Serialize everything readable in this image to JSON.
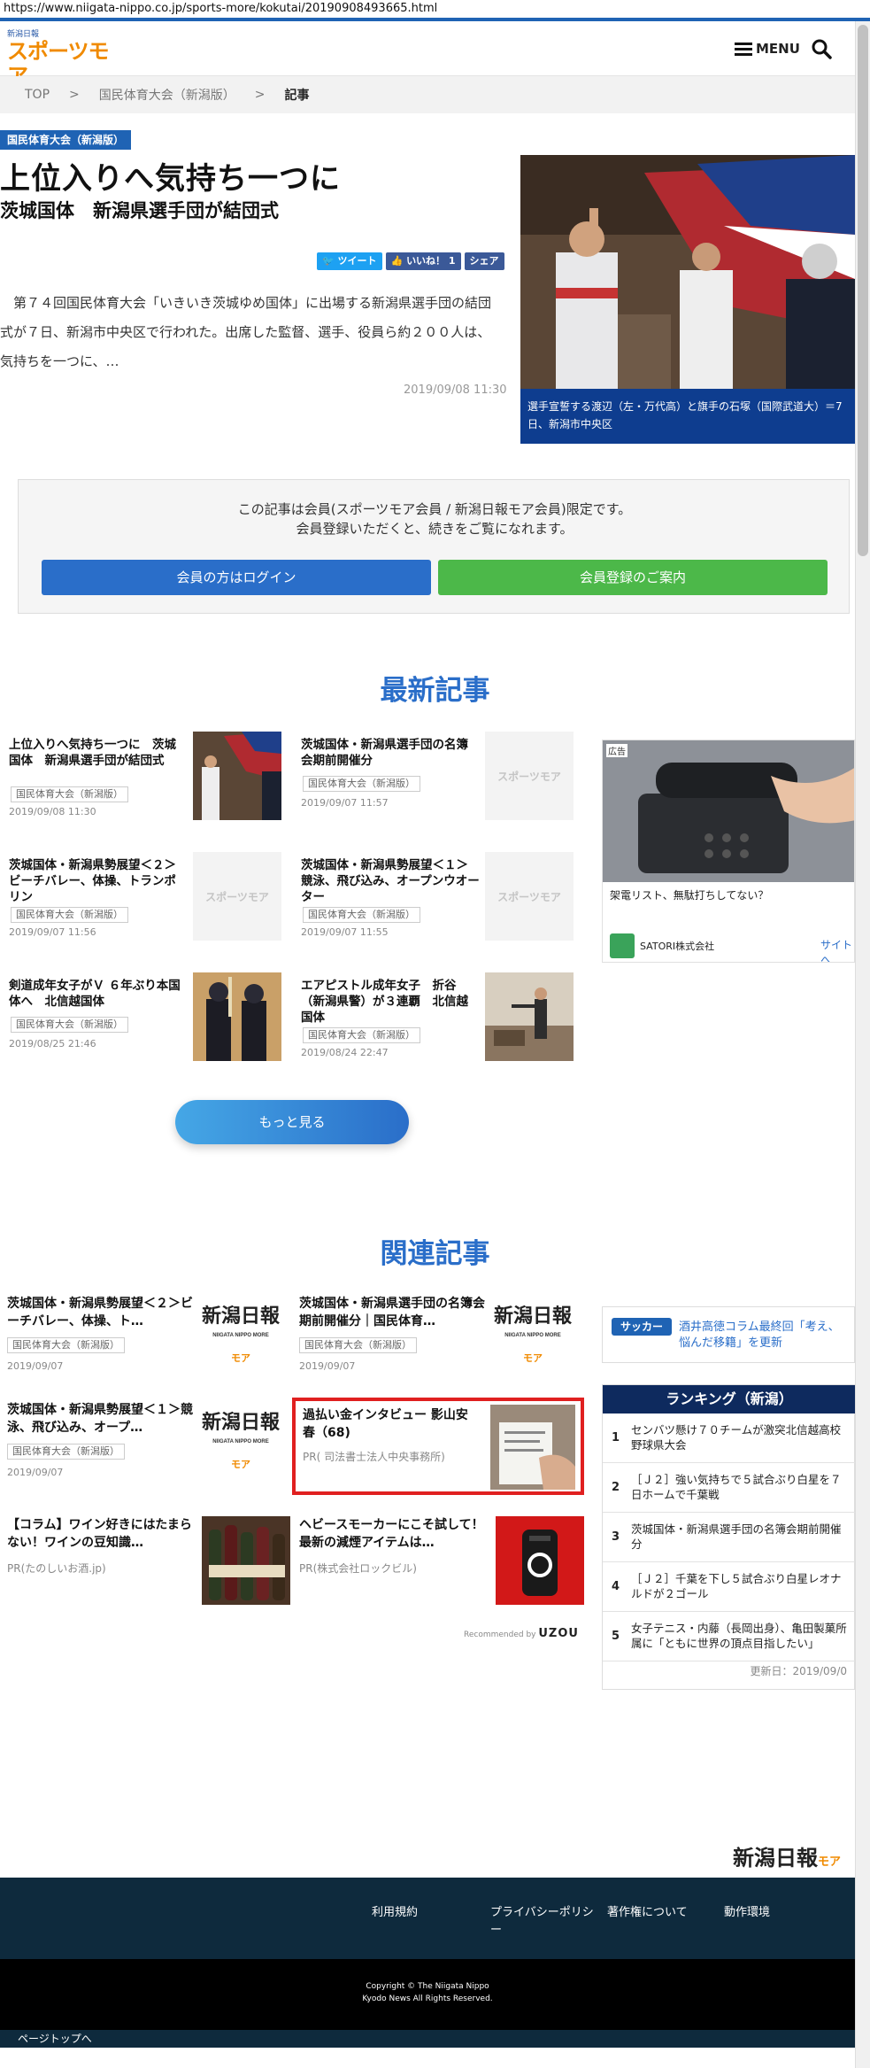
{
  "browser": {
    "url": "https://www.niigata-nippo.co.jp/sports-more/kokutai/20190908493665.html"
  },
  "header": {
    "logo_small": "新潟日報",
    "logo_main": "スポーツモア",
    "menu_label": "MENU"
  },
  "breadcrumb": [
    "TOP",
    ">",
    "国民体育大会（新潟版）",
    ">",
    "記事"
  ],
  "article": {
    "category": "国民体育大会（新潟版）",
    "title": "上位入りへ気持ち一つに",
    "subtitle": "茨城国体　新潟県選手団が結団式",
    "share": {
      "tweet": "ツイート",
      "like": "いいね！ 1",
      "share": "シェア"
    },
    "lead": "第７４回国民体育大会「いきいき茨城ゆめ国体」に出場する新潟県選手団の結団式が７日、新潟市中央区で行われた。出席した監督、選手、役員ら約２００人は、気持ちを一つに、…",
    "date": "2019/09/08 11:30",
    "photo_caption": "選手宣誓する渡辺（左・万代高）と旗手の石塚（国際武道大）＝7日、新潟市中央区"
  },
  "paywall": {
    "line1": "この記事は会員(スポーツモア会員 / 新潟日報モア会員)限定です。",
    "line2": "会員登録いただくと、続きをご覧になれます。",
    "login": "会員の方はログイン",
    "register": "会員登録のご案内"
  },
  "latest": {
    "heading": "最新記事",
    "items": [
      {
        "title": "上位入りへ気持ち一つに　茨城国体　新潟県選手団が結団式",
        "tag": "国民体育大会（新潟版）",
        "date": "2019/09/08 11:30"
      },
      {
        "title": "茨城国体・新潟県選手団の名簿　会期前開催分",
        "tag": "国民体育大会（新潟版）",
        "date": "2019/09/07 11:57"
      },
      {
        "title": "茨城国体・新潟県勢展望＜２＞　ビーチバレー、体操、トランポリン",
        "tag": "国民体育大会（新潟版）",
        "date": "2019/09/07 11:56"
      },
      {
        "title": "茨城国体・新潟県勢展望＜１＞　競泳、飛び込み、オープンウオーター",
        "tag": "国民体育大会（新潟版）",
        "date": "2019/09/07 11:55"
      },
      {
        "title": "剣道成年女子がＶ ６年ぶり本国体へ　北信越国体",
        "tag": "国民体育大会（新潟版）",
        "date": "2019/08/25 21:46"
      },
      {
        "title": "エアピストル成年女子　折谷（新潟県警）が３連覇　北信越国体",
        "tag": "国民体育大会（新潟版）",
        "date": "2019/08/24 22:47"
      }
    ],
    "placeholder_logo": "スポーツモア",
    "more": "もっと見る"
  },
  "ad": {
    "label": "広告",
    "text": "架電リスト、無駄打ちしてない？",
    "sponsor": "SATORI株式会社",
    "link": "サイトへ"
  },
  "related": {
    "heading": "関連記事",
    "items": [
      {
        "title": "茨城国体・新潟県勢展望＜２＞ビーチバレー、体操、ト…",
        "tag": "国民体育大会（新潟版）",
        "date": "2019/09/07"
      },
      {
        "title": "茨城国体・新潟県選手団の名簿会期前開催分｜国民体育…",
        "tag": "国民体育大会（新潟版）",
        "date": "2019/09/07"
      },
      {
        "title": "茨城国体・新潟県勢展望＜１＞競泳、飛び込み、オープ…",
        "tag": "国民体育大会（新潟版）",
        "date": "2019/09/07"
      },
      {
        "title": "過払い金インタビュー 影山安春（68)",
        "pr": "PR( 司法書士法人中央事務所)"
      },
      {
        "title": "【コラム】ワイン好きにはたまらない！ワインの豆知識…",
        "pr": "PR(たのしいお酒.jp)"
      },
      {
        "title": "ヘビースモーカーにこそ試して！最新の減煙アイテムは…",
        "pr": "PR(株式会社ロックビル)"
      }
    ],
    "logo_text": "新潟日報",
    "logo_sub": "NIIGATA NIPPO MORE",
    "logo_more": "モア",
    "recommended_by": "Recommended by",
    "uzou": "UZOU"
  },
  "sidebar": {
    "soccer_tag": "サッカー",
    "soccer_text": "酒井高徳コラム最終回「考え、悩んだ移籍」を更新",
    "ranking_title": "ランキング（新潟）",
    "ranking": [
      {
        "n": "1",
        "text": "センバツ懸け７０チームが激突北信越高校野球県大会"
      },
      {
        "n": "2",
        "text": "［Ｊ２］強い気持ちで５試合ぶり白星を７日ホームで千葉戦"
      },
      {
        "n": "3",
        "text": "茨城国体・新潟県選手団の名簿会期前開催分"
      },
      {
        "n": "4",
        "text": "［Ｊ２］千葉を下し５試合ぶり白星レオナルドが２ゴール"
      },
      {
        "n": "5",
        "text": "女子テニス・内藤（長岡出身）、亀田製菓所属に「ともに世界の頂点目指したい」"
      }
    ],
    "updated": "更新日：2019/09/0"
  },
  "footer": {
    "logo": "新潟日報",
    "logo_more": "モア",
    "links": [
      "利用規約",
      "プライバシーポリシー",
      "著作権について",
      "動作環境"
    ],
    "copy1": "Copyright © The Niigata Nippo",
    "copy2": "Kyodo News All Rights Reserved.",
    "pagetop": "ページトップへ"
  },
  "colors": {
    "brand_blue": "#1f63b4",
    "accent_orange": "#f08a00",
    "login_blue": "#2a6ec9",
    "register_green": "#4cb849",
    "footer_navy": "#0e2a3d"
  }
}
